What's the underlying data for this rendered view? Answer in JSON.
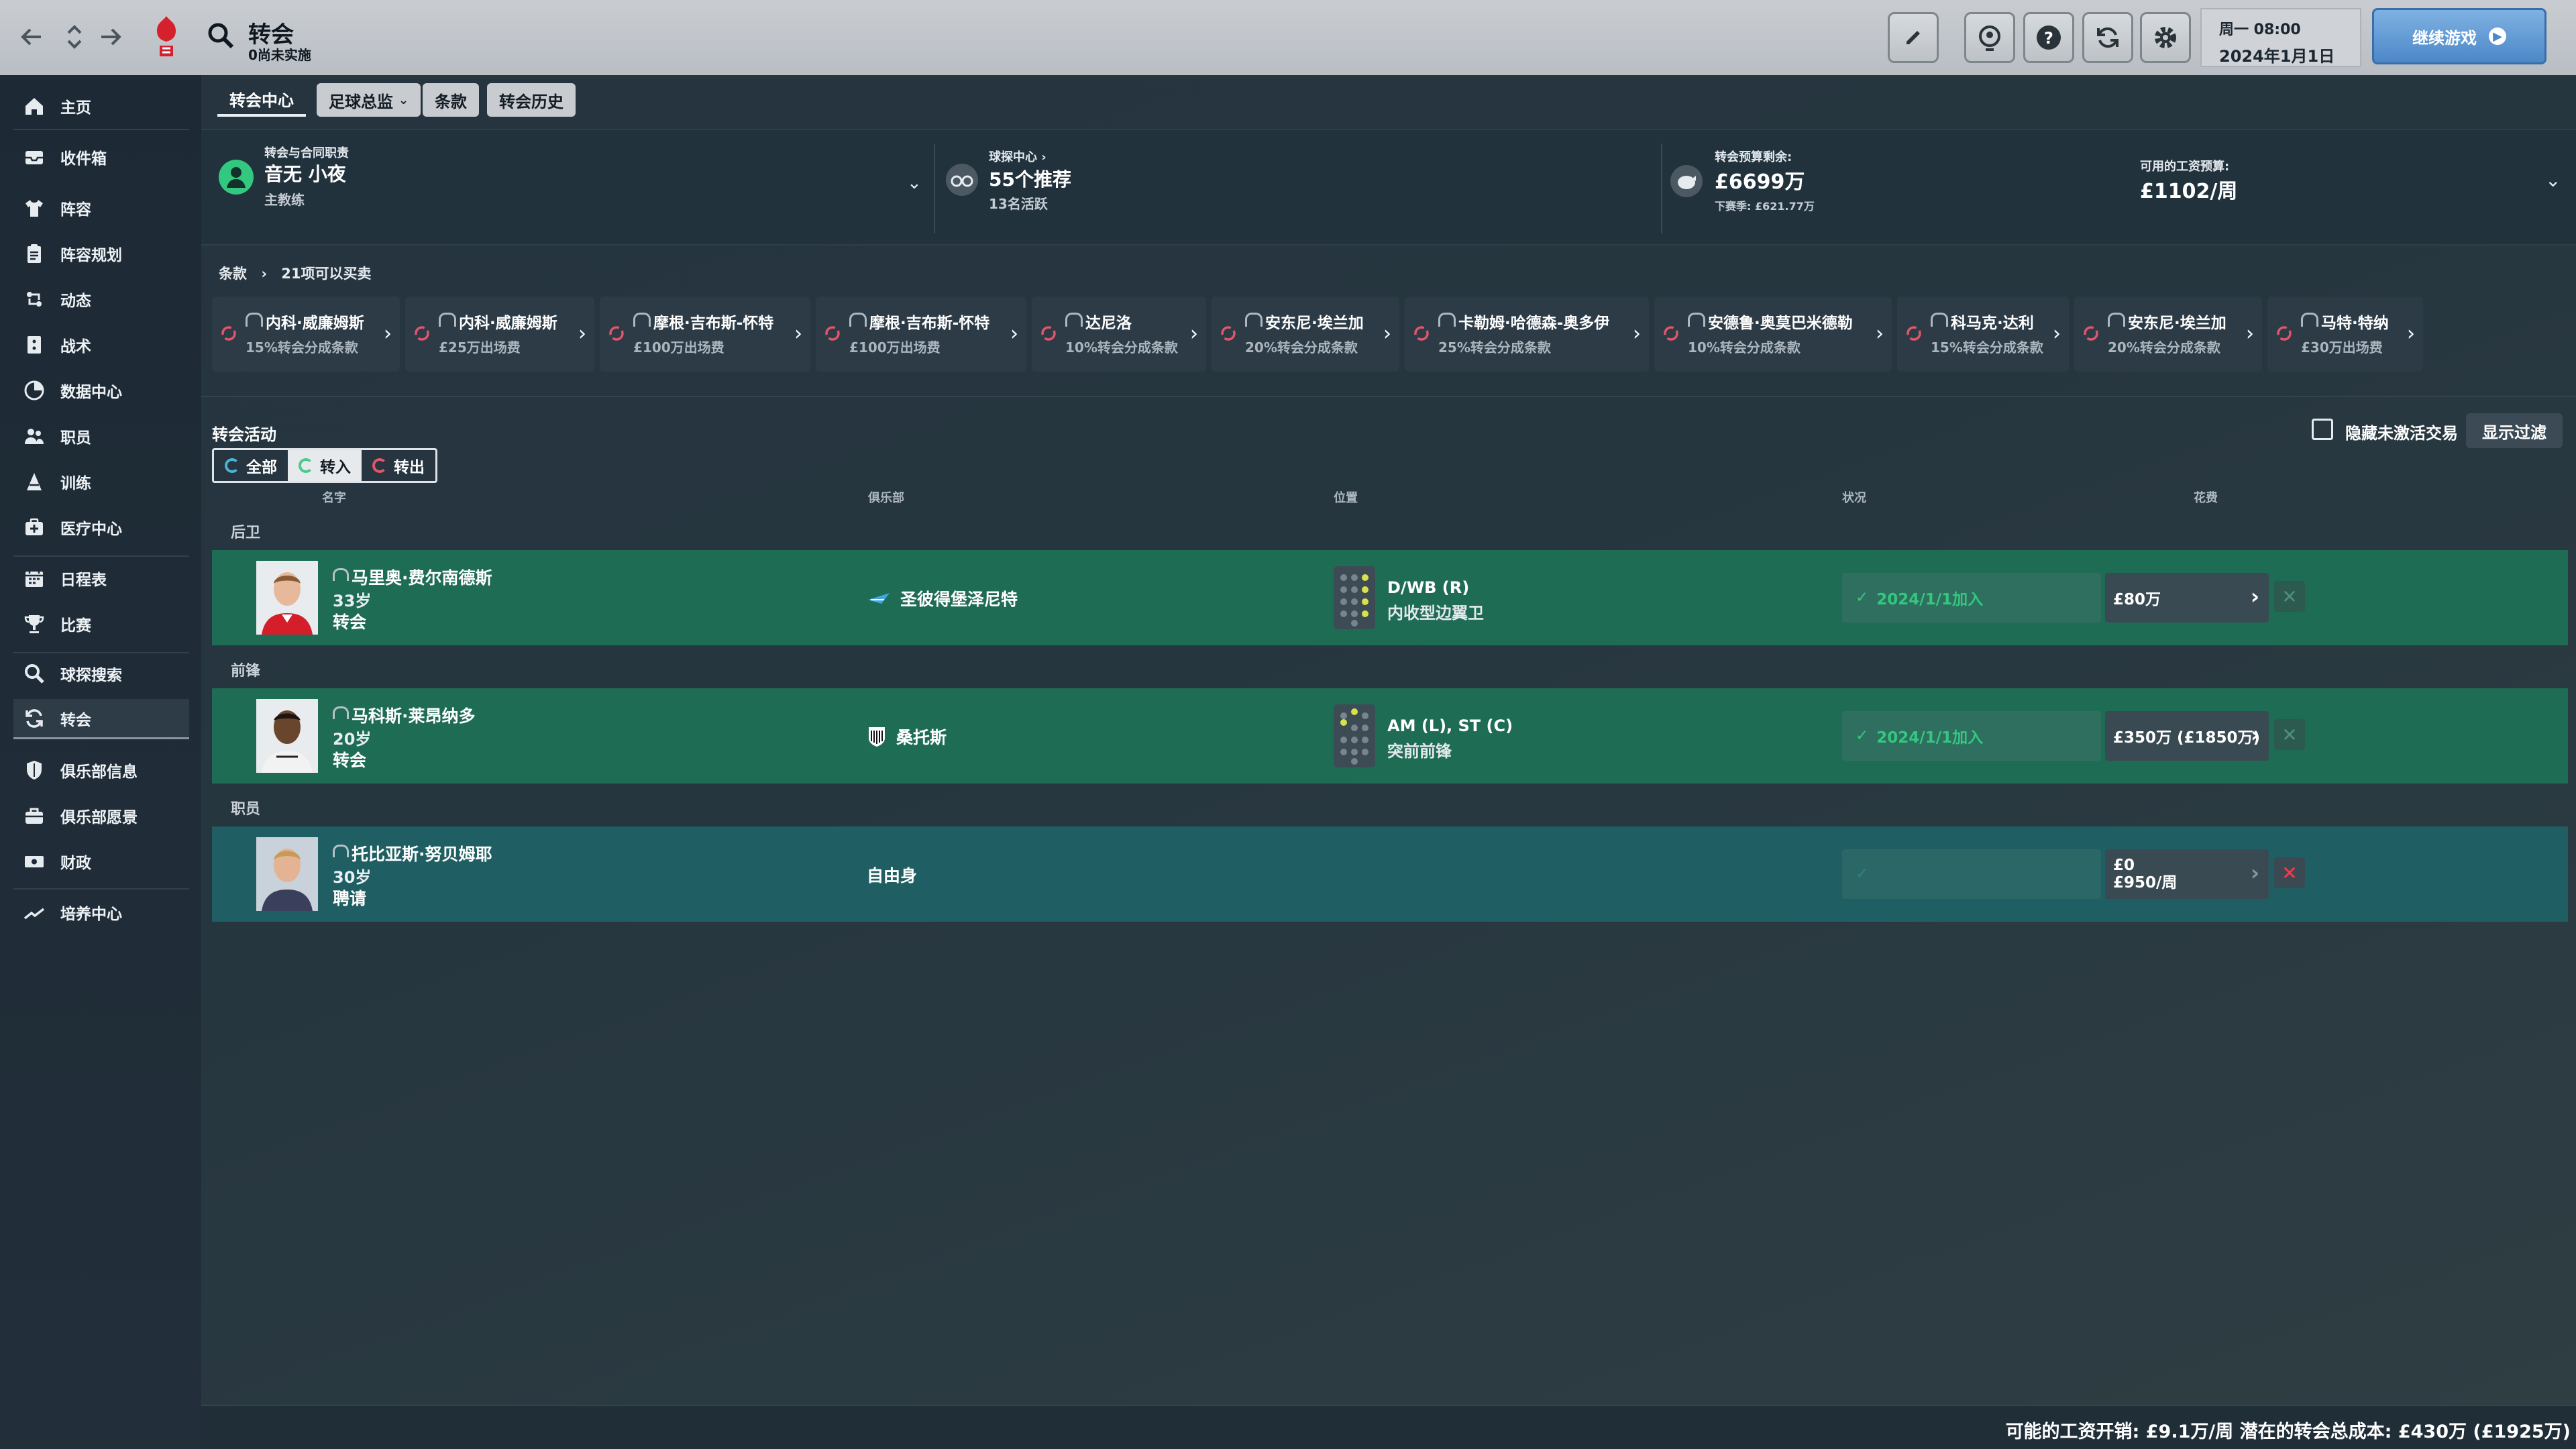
{
  "topbar": {
    "title": "转会",
    "subtitle": "0尚未实施",
    "date_line1": "周一 08:00",
    "date_line2": "2024年1月1日",
    "continue_label": "继续游戏",
    "continue_icon": "play-circle-icon"
  },
  "sidebar": {
    "items": [
      {
        "label": "主页",
        "icon": "home-icon"
      },
      {
        "label": "收件箱",
        "icon": "inbox-icon"
      },
      {
        "label": "阵容",
        "icon": "shirt-icon"
      },
      {
        "label": "阵容规划",
        "icon": "clipboard-icon"
      },
      {
        "label": "动态",
        "icon": "dynamics-icon"
      },
      {
        "label": "战术",
        "icon": "tactics-icon"
      },
      {
        "label": "数据中心",
        "icon": "data-icon"
      },
      {
        "label": "职员",
        "icon": "staff-icon"
      },
      {
        "label": "训练",
        "icon": "training-icon"
      },
      {
        "label": "医疗中心",
        "icon": "medical-icon"
      },
      {
        "label": "日程表",
        "icon": "calendar-icon"
      },
      {
        "label": "比赛",
        "icon": "trophy-icon"
      },
      {
        "label": "球探搜索",
        "icon": "scout-search-icon"
      },
      {
        "label": "转会",
        "icon": "transfer-icon"
      },
      {
        "label": "俱乐部信息",
        "icon": "shield-icon"
      },
      {
        "label": "俱乐部愿景",
        "icon": "vision-icon"
      },
      {
        "label": "财政",
        "icon": "finance-icon"
      },
      {
        "label": "培养中心",
        "icon": "development-icon"
      }
    ]
  },
  "tabs": {
    "centre": "转会中心",
    "director": "足球总监",
    "clauses": "条款",
    "history": "转会历史"
  },
  "summary": {
    "resp_label": "转会与合同职责",
    "resp_name": "音无 小夜",
    "resp_role": "主教练",
    "scout_label": "球探中心",
    "scout_recs": "55个推荐",
    "scout_active": "13名活跃",
    "budget_label": "转会预算剩余:",
    "budget_value": "£6699万",
    "budget_next": "下赛季: £621.77万",
    "wage_label": "可用的工资预算:",
    "wage_value": "£1102/周"
  },
  "clauses": {
    "crumb_root": "条款",
    "crumb_count": "21项可以买卖",
    "items": [
      {
        "name": "内科·威廉姆斯",
        "desc": "15%转会分成条款"
      },
      {
        "name": "内科·威廉姆斯",
        "desc": "£25万出场费"
      },
      {
        "name": "摩根·吉布斯-怀特",
        "desc": "£100万出场费"
      },
      {
        "name": "摩根·吉布斯-怀特",
        "desc": "£100万出场费"
      },
      {
        "name": "达尼洛",
        "desc": "10%转会分成条款"
      },
      {
        "name": "安东尼·埃兰加",
        "desc": "20%转会分成条款"
      },
      {
        "name": "卡勒姆·哈德森-奥多伊",
        "desc": "25%转会分成条款"
      },
      {
        "name": "安德鲁·奥莫巴米德勒",
        "desc": "10%转会分成条款"
      },
      {
        "name": "科马克·达利",
        "desc": "15%转会分成条款"
      },
      {
        "name": "安东尼·埃兰加",
        "desc": "20%转会分成条款"
      },
      {
        "name": "马特·特纳",
        "desc": "£30万出场费"
      }
    ]
  },
  "activity": {
    "title": "转会活动",
    "filter_all": "全部",
    "filter_in": "转入",
    "filter_out": "转出",
    "hide_inactive": "隐藏未激活交易",
    "show_filter": "显示过滤",
    "col_name": "名字",
    "col_club": "俱乐部",
    "col_position": "位置",
    "col_status": "状况",
    "col_fee": "花费",
    "group_defenders": "后卫",
    "group_forwards": "前锋",
    "group_staff": "职员",
    "rows": [
      {
        "name": "马里奥·费尔南德斯",
        "age": "33岁",
        "type": "转会",
        "club": "圣彼得堡泽尼特",
        "pos": "D/WB (R)",
        "role": "内收型边翼卫",
        "status": "2024/1/1加入",
        "fee": "£80万"
      },
      {
        "name": "马科斯·莱昂纳多",
        "age": "20岁",
        "type": "转会",
        "club": "桑托斯",
        "pos": "AM (L), ST (C)",
        "role": "突前前锋",
        "status": "2024/1/1加入",
        "fee": "£350万 (£1850万)"
      },
      {
        "name": "托比亚斯·努贝姆耶",
        "age": "30岁",
        "type": "聘请",
        "club": "自由身",
        "status": "",
        "fee1": "£0",
        "fee2": "£950/周"
      }
    ]
  },
  "footer": {
    "text": "可能的工资开销: £9.1万/周 潜在的转会总成本: £430万 (£1925万)"
  },
  "colors": {
    "accent_green": "#33c87f",
    "row_green": "#1f6c55",
    "row_teal": "#1f5e62",
    "cancel_red": "#ef3f4f",
    "continue_blue": "#4c87c7"
  }
}
